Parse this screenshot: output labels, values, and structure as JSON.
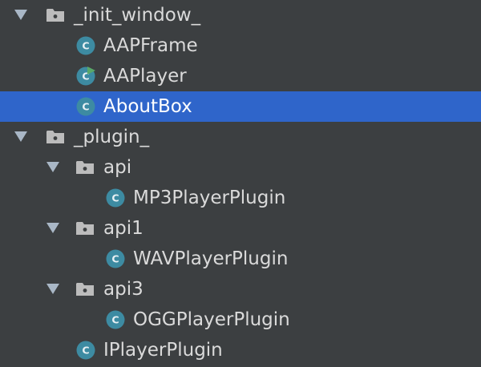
{
  "tree": {
    "nodes": [
      {
        "kind": "package",
        "expanded": true,
        "label": "_init_window_",
        "icon": "package-folder-icon"
      },
      {
        "kind": "class",
        "label": "AAPFrame",
        "icon": "class-icon"
      },
      {
        "kind": "class",
        "label": "AAPlayer",
        "icon": "runnable-class-icon"
      },
      {
        "kind": "class",
        "label": "AboutBox",
        "icon": "class-icon",
        "selected": true
      },
      {
        "kind": "package",
        "expanded": true,
        "label": "_plugin_",
        "icon": "package-folder-icon"
      },
      {
        "kind": "package",
        "expanded": true,
        "label": "api",
        "icon": "package-folder-icon"
      },
      {
        "kind": "class",
        "label": "MP3PlayerPlugin",
        "icon": "class-icon"
      },
      {
        "kind": "package",
        "expanded": true,
        "label": "api1",
        "icon": "package-folder-icon"
      },
      {
        "kind": "class",
        "label": "WAVPlayerPlugin",
        "icon": "class-icon"
      },
      {
        "kind": "package",
        "expanded": true,
        "label": "api3",
        "icon": "package-folder-icon"
      },
      {
        "kind": "class",
        "label": "OGGPlayerPlugin",
        "icon": "class-icon"
      },
      {
        "kind": "class",
        "label": "IPlayerPlugin",
        "icon": "class-icon"
      }
    ]
  },
  "colors": {
    "background": "#3c3f41",
    "selection": "#2f65ca",
    "text": "#dadada",
    "selected_text": "#ffffff",
    "class_icon": "#3d8ba2",
    "run_marker": "#59a869",
    "folder": "#bcbcbc"
  }
}
